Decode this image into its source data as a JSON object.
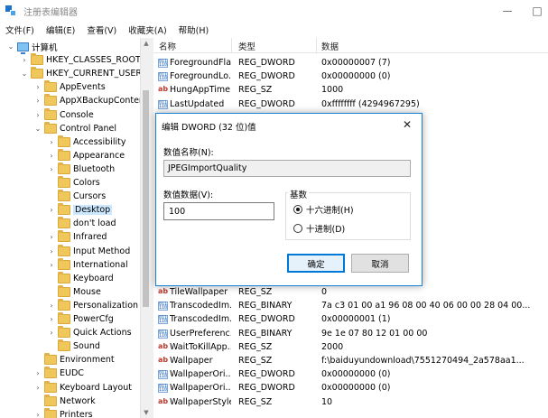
{
  "window": {
    "title": "注册表编辑器"
  },
  "menu": [
    "文件(F)",
    "编辑(E)",
    "查看(V)",
    "收藏夹(A)",
    "帮助(H)"
  ],
  "tree": [
    {
      "label": "计算机",
      "level": 0,
      "arrow": "down",
      "icon": "pc"
    },
    {
      "label": "HKEY_CLASSES_ROOT",
      "level": 1,
      "arrow": "right"
    },
    {
      "label": "HKEY_CURRENT_USER",
      "level": 1,
      "arrow": "down"
    },
    {
      "label": "AppEvents",
      "level": 2,
      "arrow": "right"
    },
    {
      "label": "AppXBackupConter",
      "level": 2,
      "arrow": "right"
    },
    {
      "label": "Console",
      "level": 2,
      "arrow": "right"
    },
    {
      "label": "Control Panel",
      "level": 2,
      "arrow": "down"
    },
    {
      "label": "Accessibility",
      "level": 3,
      "arrow": "right"
    },
    {
      "label": "Appearance",
      "level": 3,
      "arrow": "right"
    },
    {
      "label": "Bluetooth",
      "level": 3,
      "arrow": "right"
    },
    {
      "label": "Colors",
      "level": 3,
      "arrow": "none"
    },
    {
      "label": "Cursors",
      "level": 3,
      "arrow": "none"
    },
    {
      "label": "Desktop",
      "level": 3,
      "arrow": "right",
      "selected": true
    },
    {
      "label": "don't load",
      "level": 3,
      "arrow": "none"
    },
    {
      "label": "Infrared",
      "level": 3,
      "arrow": "right"
    },
    {
      "label": "Input Method",
      "level": 3,
      "arrow": "right"
    },
    {
      "label": "International",
      "level": 3,
      "arrow": "right"
    },
    {
      "label": "Keyboard",
      "level": 3,
      "arrow": "none"
    },
    {
      "label": "Mouse",
      "level": 3,
      "arrow": "none"
    },
    {
      "label": "Personalization",
      "level": 3,
      "arrow": "right"
    },
    {
      "label": "PowerCfg",
      "level": 3,
      "arrow": "right"
    },
    {
      "label": "Quick Actions",
      "level": 3,
      "arrow": "right"
    },
    {
      "label": "Sound",
      "level": 3,
      "arrow": "none"
    },
    {
      "label": "Environment",
      "level": 2,
      "arrow": "none"
    },
    {
      "label": "EUDC",
      "level": 2,
      "arrow": "right"
    },
    {
      "label": "Keyboard Layout",
      "level": 2,
      "arrow": "right"
    },
    {
      "label": "Network",
      "level": 2,
      "arrow": "none"
    },
    {
      "label": "Printers",
      "level": 2,
      "arrow": "right"
    }
  ],
  "list": {
    "headers": {
      "name": "名称",
      "type": "类型",
      "data": "数据"
    },
    "rows_top": [
      {
        "name": "ForegroundFla...",
        "type": "REG_DWORD",
        "data": "0x00000007 (7)",
        "icon": "bin"
      },
      {
        "name": "ForegroundLo...",
        "type": "REG_DWORD",
        "data": "0x00000000 (0)",
        "icon": "bin"
      },
      {
        "name": "HungAppTime...",
        "type": "REG_SZ",
        "data": "1000",
        "icon": "sz"
      },
      {
        "name": "LastUpdated",
        "type": "REG_DWORD",
        "data": "0xffffffff (4294967295)",
        "icon": "bin"
      }
    ],
    "rows_bottom": [
      {
        "name": "TileWallpaper",
        "type": "REG_SZ",
        "data": "0",
        "icon": "sz"
      },
      {
        "name": "TranscodedIm...",
        "type": "REG_BINARY",
        "data": "7a c3 01 00 a1 96 08 00 40 06 00 00 28 04 00...",
        "icon": "bin"
      },
      {
        "name": "TranscodedIm...",
        "type": "REG_DWORD",
        "data": "0x00000001 (1)",
        "icon": "bin"
      },
      {
        "name": "UserPreferenc...",
        "type": "REG_BINARY",
        "data": "9e 1e 07 80 12 01 00 00",
        "icon": "bin"
      },
      {
        "name": "WaitToKillApp...",
        "type": "REG_SZ",
        "data": "2000",
        "icon": "sz"
      },
      {
        "name": "Wallpaper",
        "type": "REG_SZ",
        "data": "f:\\baiduyundownload\\7551270494_2a578aa1...",
        "icon": "sz"
      },
      {
        "name": "WallpaperOri...",
        "type": "REG_DWORD",
        "data": "0x00000000 (0)",
        "icon": "bin"
      },
      {
        "name": "WallpaperOri...",
        "type": "REG_DWORD",
        "data": "0x00000000 (0)",
        "icon": "bin"
      },
      {
        "name": "WallpaperStyle",
        "type": "REG_SZ",
        "data": "10",
        "icon": "sz"
      }
    ]
  },
  "dialog": {
    "title": "编辑 DWORD (32 位)值",
    "value_name_label": "数值名称(N):",
    "value_name": "JPEGImportQuality",
    "value_data_label": "数值数据(V):",
    "value_data": "100",
    "base_label": "基数",
    "hex_label": "十六进制(H)",
    "dec_label": "十进制(D)",
    "ok_label": "确定",
    "cancel_label": "取消"
  }
}
